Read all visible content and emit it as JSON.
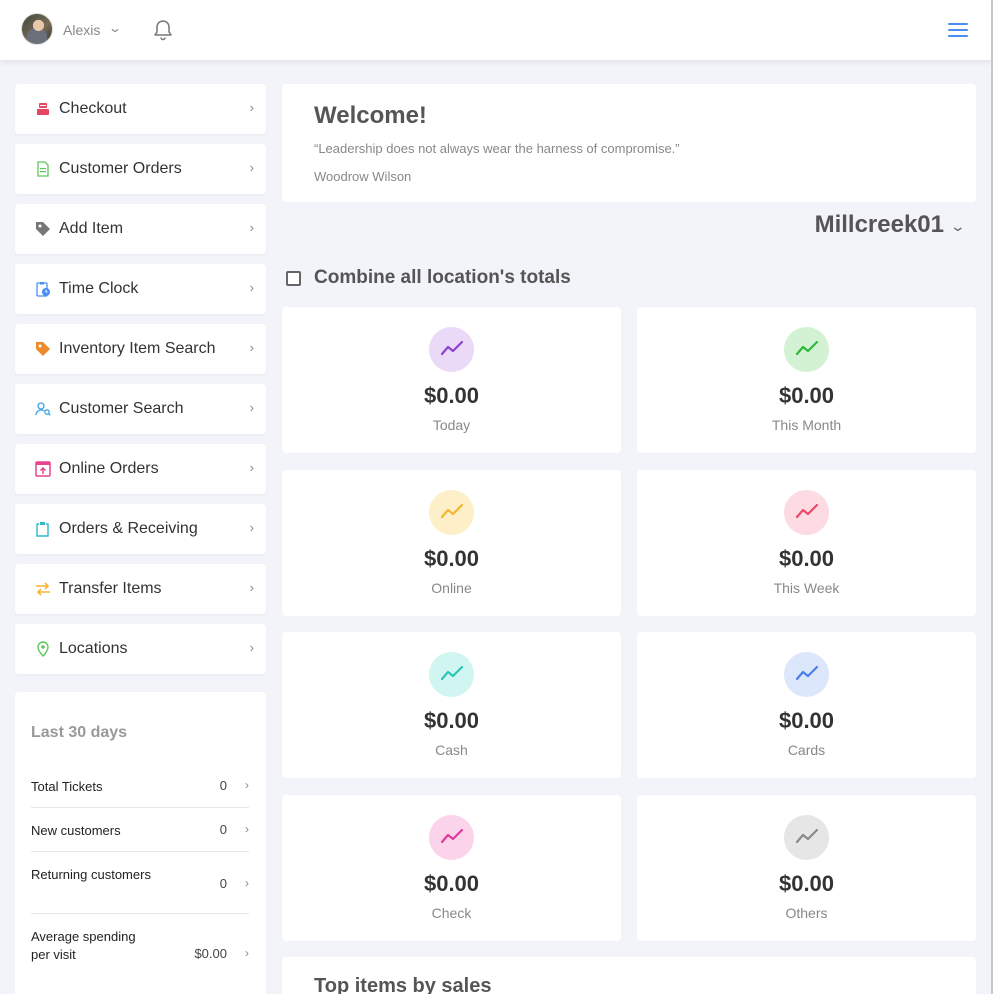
{
  "header": {
    "user_name": "Alexis",
    "user_chevron": "⌄",
    "bell_icon": "bell-icon",
    "menu_icon": "hamburger-icon"
  },
  "sidebar": {
    "items": [
      {
        "label": "Checkout",
        "icon": "register-icon",
        "color": "#e8455f"
      },
      {
        "label": "Customer Orders",
        "icon": "document-icon",
        "color": "#5cc75c"
      },
      {
        "label": "Add Item",
        "icon": "tag-icon",
        "color": "#777777"
      },
      {
        "label": "Time Clock",
        "icon": "clipboard-clock-icon",
        "color": "#4a8ef1"
      },
      {
        "label": "Inventory Item Search",
        "icon": "tag-search-icon",
        "color": "#f08a2c"
      },
      {
        "label": "Customer Search",
        "icon": "user-search-icon",
        "color": "#3aa4e6"
      },
      {
        "label": "Online Orders",
        "icon": "upload-box-icon",
        "color": "#e8458f"
      },
      {
        "label": "Orders & Receiving",
        "icon": "clipboard-icon",
        "color": "#2fb8c8"
      },
      {
        "label": "Transfer Items",
        "icon": "transfer-arrows-icon",
        "color": "#f5b533"
      },
      {
        "label": "Locations",
        "icon": "map-pin-icon",
        "color": "#5cc75c"
      }
    ],
    "chevron": "›"
  },
  "stats": {
    "title": "Last 30 days",
    "rows": [
      {
        "label": "Total Tickets",
        "value": "0"
      },
      {
        "label": "New customers",
        "value": "0"
      },
      {
        "label": "Returning customers",
        "value": "0"
      },
      {
        "label": "Average spending per visit",
        "value": "$0.00"
      }
    ]
  },
  "welcome": {
    "title": "Welcome!",
    "quote": "“Leadership does not always wear the harness of compromise.”",
    "author": "Woodrow Wilson"
  },
  "location": {
    "name": "Millcreek01",
    "chevron": "⌄"
  },
  "combine": {
    "label": "Combine all location's totals",
    "checked": false
  },
  "tiles": [
    {
      "amount": "$0.00",
      "label": "Today",
      "bg": "#ead9f7",
      "stroke": "#8b44d0"
    },
    {
      "amount": "$0.00",
      "label": "This Month",
      "bg": "#d3f2d3",
      "stroke": "#2fb83a"
    },
    {
      "amount": "$0.00",
      "label": "Online",
      "bg": "#fdf0c8",
      "stroke": "#f2b72e"
    },
    {
      "amount": "$0.00",
      "label": "This Week",
      "bg": "#fcdbe2",
      "stroke": "#ee4a6a"
    },
    {
      "amount": "$0.00",
      "label": "Cash",
      "bg": "#d1f5f1",
      "stroke": "#2cc6b6"
    },
    {
      "amount": "$0.00",
      "label": "Cards",
      "bg": "#dce7fc",
      "stroke": "#4a7fe8"
    },
    {
      "amount": "$0.00",
      "label": "Check",
      "bg": "#fbd3ea",
      "stroke": "#e23a9c"
    },
    {
      "amount": "$0.00",
      "label": "Others",
      "bg": "#e6e6e6",
      "stroke": "#8a8a8a"
    }
  ],
  "bottom_section": {
    "title": "Top items by sales"
  }
}
